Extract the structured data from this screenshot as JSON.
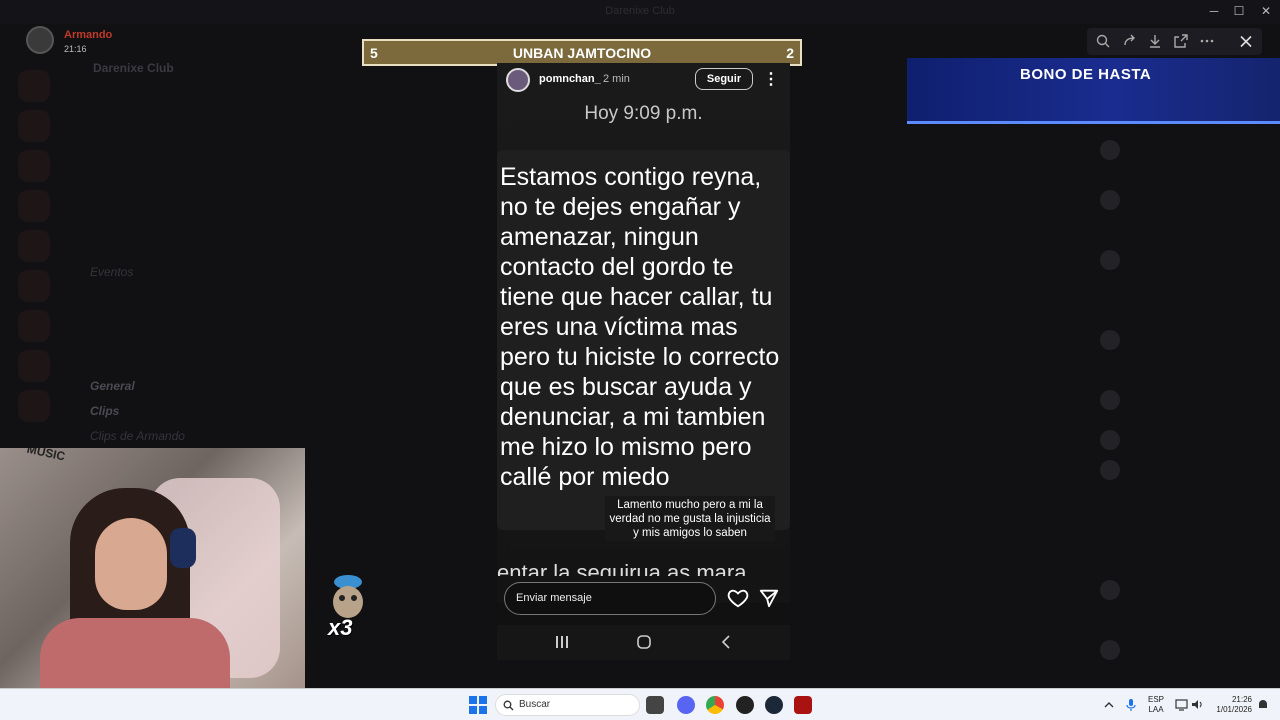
{
  "window": {
    "title": "Darenixe Club",
    "minimize": "─",
    "maximize": "☐",
    "close": "✕"
  },
  "user": {
    "name": "Armando",
    "time": "21:16"
  },
  "server": {
    "name": "Darenixe Club",
    "channels": [
      {
        "label": "Eventos",
        "highlight": false
      },
      {
        "label": "General",
        "highlight": true
      },
      {
        "label": "Clips",
        "highlight": true
      },
      {
        "label": "Clips de Armando",
        "highlight": false
      }
    ]
  },
  "banner": {
    "left": "5",
    "center": "UNBAN JAMTOCINO",
    "right": "2"
  },
  "story": {
    "username": "pomnchan_",
    "age": "2 min",
    "follow_label": "Seguir",
    "more_label": "⋮",
    "date": "Hoy 9:09 p.m.",
    "message": "Estamos contigo reyna, no te dejes engañar y amenazar, ningun contacto del gordo te tiene que hacer callar, tu eres una víctima mas pero tu hiciste lo correcto que es buscar ayuda y denunciar, a mi tambien me hizo lo mismo pero callé por miedo",
    "caption": "Lamento mucho pero a mi la verdad no me gusta la injusticia y mis amigos lo saben",
    "overflow_text": "entar la sequirua as mara",
    "reply_placeholder": "Enviar mensaje"
  },
  "promo": {
    "text": "BONO DE HASTA"
  },
  "overlay": {
    "multiplier": "x3"
  },
  "webcam": {
    "banner": "MUSIC"
  },
  "taskbar": {
    "search_label": "Buscar",
    "lang_top": "ESP",
    "lang_bottom": "LAA",
    "time": "21:26",
    "date": "1/01/2026"
  },
  "colors": {
    "accent_gold": "#7c6a3c",
    "promo_blue": "#1a2c8f",
    "username_red": "#c0392b"
  }
}
